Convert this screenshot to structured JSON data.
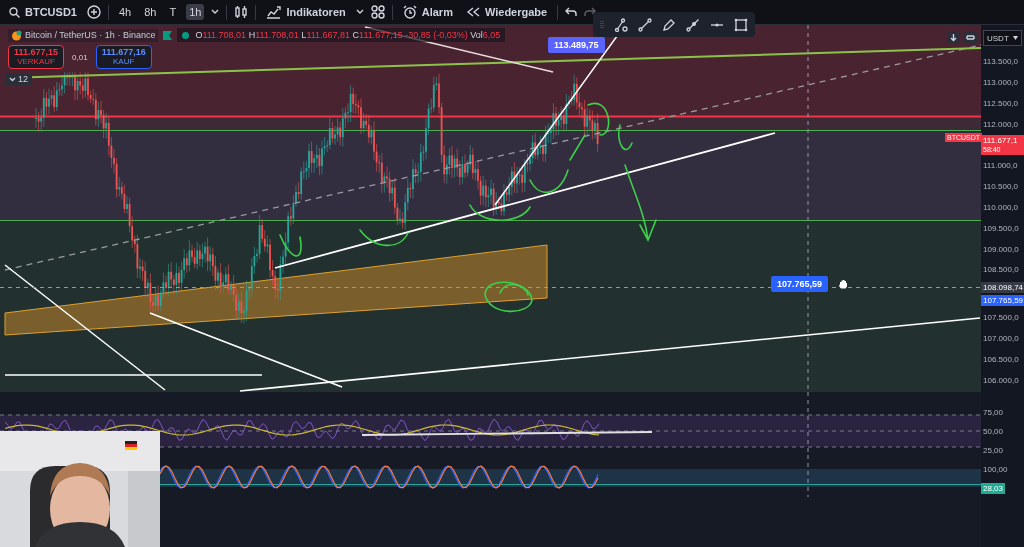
{
  "toolbar": {
    "symbol": "BTCUSD1",
    "intervals": [
      {
        "label": "4h",
        "selected": false
      },
      {
        "label": "8h",
        "selected": false
      },
      {
        "label": "T",
        "selected": false
      },
      {
        "label": "1h",
        "selected": true
      }
    ],
    "indicators": "Indikatoren",
    "alert": "Alarm",
    "replay": "Wiedergabe"
  },
  "legend": {
    "title": "Bitcoin / TetherUS · 1h · Binance",
    "ohlc": [
      {
        "key": "O",
        "value": "111.708,01"
      },
      {
        "key": "H",
        "value": "111.708,01"
      },
      {
        "key": "L",
        "value": "111.667,81"
      },
      {
        "key": "C",
        "value": "111.677,15"
      }
    ],
    "change": "-30,85 (-0,03%)",
    "volume_key": "Vol",
    "volume": "6,05"
  },
  "trade": {
    "sell": {
      "price": "111.677,15",
      "label": "VERKAUF"
    },
    "spread": "0,01",
    "buy": {
      "price": "111.677,16",
      "label": "KAUF"
    }
  },
  "collapse_count": "12",
  "callouts": [
    {
      "text": "113.489,75"
    },
    {
      "text": "107.765,59"
    }
  ],
  "currency": "USDT",
  "price_axis": [
    {
      "kind": "tick",
      "text": "113.500,0"
    },
    {
      "kind": "tick",
      "text": "113.000,0"
    },
    {
      "kind": "tick",
      "text": "112.500,0"
    },
    {
      "kind": "tick",
      "text": "112.000,0"
    },
    {
      "kind": "last",
      "text": "111.677,1",
      "sub": "58:40",
      "tag": "BTCUSDT"
    },
    {
      "kind": "tick",
      "text": "111.000,0"
    },
    {
      "kind": "tick",
      "text": "110.500,0"
    },
    {
      "kind": "tick",
      "text": "110.000,0"
    },
    {
      "kind": "tick",
      "text": "109.500,0"
    },
    {
      "kind": "tick",
      "text": "109.000,0"
    },
    {
      "kind": "tick",
      "text": "108.500,0"
    },
    {
      "kind": "crosshair",
      "text": "108.098,74"
    },
    {
      "kind": "alert",
      "text": "107.765,59"
    },
    {
      "kind": "tick",
      "text": "107.500,0"
    },
    {
      "kind": "tick",
      "text": "107.000,0"
    },
    {
      "kind": "tick",
      "text": "106.500,0"
    },
    {
      "kind": "tick",
      "text": "106.000,0"
    }
  ],
  "indicator_axis": [
    {
      "kind": "tick",
      "text": "75,00"
    },
    {
      "kind": "tick",
      "text": "50,00"
    },
    {
      "kind": "tick",
      "text": "25,00"
    },
    {
      "kind": "tick",
      "text": "100,00"
    },
    {
      "kind": "value",
      "text": "28,03"
    }
  ]
}
